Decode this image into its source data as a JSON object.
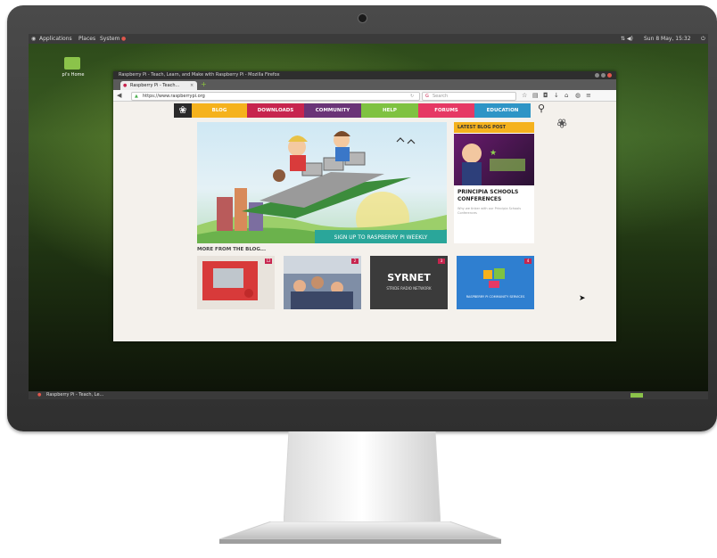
{
  "desktop": {
    "top_panel": {
      "menus": [
        "Applications",
        "Places",
        "System"
      ],
      "clock": "Sun 8 May, 15:32"
    },
    "icon_label": "pi's Home"
  },
  "browser": {
    "window_title": "Raspberry Pi - Teach, Learn, and Make with Raspberry Pi - Mozilla Firefox",
    "tab_title": "Raspberry Pi - Teach...",
    "url": "https://www.raspberrypi.org",
    "search_placeholder": "Search"
  },
  "site": {
    "nav": [
      {
        "label": "BLOG",
        "color": "#f5b21d"
      },
      {
        "label": "DOWNLOADS",
        "color": "#c7254e"
      },
      {
        "label": "COMMUNITY",
        "color": "#6a3477"
      },
      {
        "label": "HELP",
        "color": "#7fc241"
      },
      {
        "label": "FORUMS",
        "color": "#e63964"
      },
      {
        "label": "EDUCATION",
        "color": "#2e95c6"
      }
    ],
    "hero_cta": "SIGN UP TO RASPBERRY PI WEEKLY",
    "latest": {
      "heading": "LATEST BLOG POST",
      "title": "PRINCIPIA SCHOOLS CONFERENCES",
      "excerpt": "Why we tinker with our Principia Schools Conferences"
    },
    "more_heading": "MORE FROM THE BLOG...",
    "thumbs": [
      {
        "badge": "12",
        "caption": ""
      },
      {
        "badge": "2",
        "caption": ""
      },
      {
        "badge": "3",
        "caption": "SYRNET",
        "subcaption": "STRIDE RADIO NETWORK"
      },
      {
        "badge": "4",
        "caption": "",
        "subcaption": "RASPBERRY PI COMMUNITY SERVICES"
      }
    ]
  },
  "taskbar": {
    "item": "Raspberry Pi - Teach, Le..."
  },
  "colors": {
    "accent_green": "#8bc34a",
    "rpi_teal": "#2aa69a"
  }
}
